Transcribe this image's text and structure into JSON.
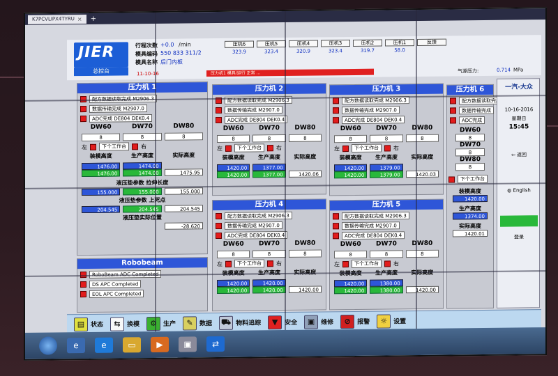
{
  "window": {
    "tab_title": "K7PCVLIPX4TYRU",
    "tab_close": "×",
    "tab_new": "+"
  },
  "header": {
    "logo": "JIER",
    "logo_sub": "总控台",
    "row1_label": "行程次数",
    "row1_value": "+0.0",
    "row1_unit": "/min",
    "row2_label": "模具编码",
    "row2_value": "550 833 311/2",
    "row3_label": "模具名称",
    "row3_value": "后门内板",
    "date_text": "11-10-16",
    "red_message": "压力机1 模具/运行 正常 ...",
    "pressure_label": "气源压力:",
    "pressure_value": "0.714",
    "pressure_unit": "MPa",
    "presses": [
      {
        "label": "压机6",
        "value": "323.9"
      },
      {
        "label": "压机5",
        "value": "323.4"
      },
      {
        "label": "压机4",
        "value": "320.9"
      },
      {
        "label": "压机3",
        "value": "323.4"
      },
      {
        "label": "压机2",
        "value": "319.7"
      },
      {
        "label": "压机1",
        "value": "58.0"
      },
      {
        "label": "反馈",
        "value": ""
      }
    ]
  },
  "common": {
    "cmd_read": "配方数据读取完成",
    "cmd_transfer": "数据传输完成",
    "adc_done": "ADC完成",
    "next_station": "下个工作台",
    "left": "左",
    "right": "右",
    "h_mold": "装模高度",
    "h_prod": "生产高度",
    "h_actual": "实际高度",
    "dw60": "DW60",
    "dw70": "DW70",
    "dw80": "DW80"
  },
  "press1": {
    "title": "压力机 1",
    "recipe": "M2906.3",
    "transfer": "M2907.0",
    "adc": "DE804 DEK0.4",
    "dw60": "8",
    "dw70": "8",
    "dw80": "8",
    "mold_h_set": "1476.00",
    "mold_h_act": "1476.00",
    "prod_h_set": "1474.00",
    "prod_h_act": "1474.00",
    "actual_h": "1475.95",
    "cushion_label": "液压垫参数 拉伸长度",
    "cush_a": "155.000",
    "cush_b": "155.000",
    "cush_c": "155.000",
    "cushion_label2": "液压垫参数 上死点",
    "cush_d": "204.545",
    "cush_e": "204.545",
    "cush_f": "204.545",
    "cushion_pos_label": "液压垫实际位置",
    "cushion_pos": "-28.620"
  },
  "press2": {
    "title": "压力机 2",
    "recipe": "M2906.3",
    "transfer": "M2907.0",
    "adc": "DE804 DEK0.4",
    "dw60": "8",
    "dw70": "8",
    "dw80": "8",
    "mold_h_set": "1420.00",
    "mold_h_act": "1420.00",
    "prod_h_set": "1377.00",
    "prod_h_act": "1377.00",
    "actual_h": "1420.06"
  },
  "press3": {
    "title": "压力机 3",
    "recipe": "M2906.3",
    "transfer": "M2907.0",
    "adc": "DE804 DEK0.4",
    "dw60": "8",
    "dw70": "8",
    "dw80": "8",
    "mold_h_set": "1420.00",
    "mold_h_act": "1420.00",
    "prod_h_set": "1379.00",
    "prod_h_act": "1379.00",
    "actual_h": "1420.03"
  },
  "press4": {
    "title": "压力机 4",
    "recipe": "M2906.3",
    "transfer": "M2907.0",
    "adc": "DE804 DEK0.4",
    "dw60": "8",
    "dw70": "8",
    "dw80": "8",
    "mold_h_set": "1420.00",
    "mold_h_act": "1420.00",
    "prod_h_set": "1420.00",
    "prod_h_act": "1420.00",
    "actual_h": "1420.00"
  },
  "press5": {
    "title": "压力机 5",
    "recipe": "M2906.3",
    "transfer": "M2907.0",
    "adc": "DE804 DEK0.4",
    "dw60": "8",
    "dw70": "8",
    "dw80": "8",
    "mold_h_set": "1420.00",
    "mold_h_act": "1420.00",
    "prod_h_set": "1380.00",
    "prod_h_act": "1380.00",
    "actual_h": "1420.00"
  },
  "press6": {
    "title": "压力机 6",
    "recipe": "配方数据读取完成",
    "transfer": "数据传输完成",
    "adc": "ADC完成",
    "dw60": "8",
    "dw70": "8",
    "dw80": "8",
    "mold_h": "1420.00",
    "prod_h": "1374.00",
    "actual_h": "1420.01"
  },
  "robobeam": {
    "title": "Robobeam",
    "adc": "RoboBeam ADC Completed",
    "ds": "DS APC Completed",
    "eol": "EOL APC Completed"
  },
  "sidebar": {
    "brand": "一汽-大众",
    "date": "10-16-2016",
    "day": "星期日",
    "time": "15:45",
    "back": "返回",
    "english": "English",
    "login": "登录"
  },
  "toolbar": [
    {
      "label": "状态",
      "icon": "status-icon"
    },
    {
      "label": "换模",
      "icon": "change-mold-icon"
    },
    {
      "label": "生产",
      "icon": "production-icon"
    },
    {
      "label": "数据",
      "icon": "data-icon"
    },
    {
      "label": "物料追踪",
      "icon": "tracking-icon"
    },
    {
      "label": "安全",
      "icon": "safety-icon"
    },
    {
      "label": "维修",
      "icon": "maintenance-icon"
    },
    {
      "label": "报警",
      "icon": "alarm-icon"
    },
    {
      "label": "设置",
      "icon": "settings-icon"
    }
  ],
  "colors": {
    "accent": "#2e56d8",
    "alarm": "#e21c1c",
    "ok": "#29b83a"
  }
}
